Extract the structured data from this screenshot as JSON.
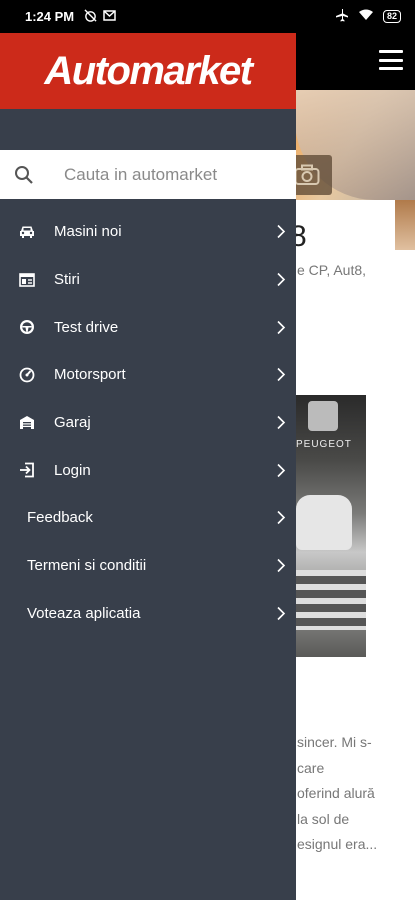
{
  "status_bar": {
    "time": "1:24 PM",
    "battery": "82"
  },
  "drawer": {
    "logo": "Automarket",
    "search": {
      "placeholder": "Cauta in automarket"
    },
    "items": [
      {
        "label": "Masini noi",
        "icon": "car-icon"
      },
      {
        "label": "Stiri",
        "icon": "news-icon"
      },
      {
        "label": "Test drive",
        "icon": "steering-wheel-icon"
      },
      {
        "label": "Motorsport",
        "icon": "speedometer-icon"
      },
      {
        "label": "Garaj",
        "icon": "garage-icon"
      },
      {
        "label": "Login",
        "icon": "login-icon"
      },
      {
        "label": "Feedback",
        "icon": ""
      },
      {
        "label": "Termeni si conditii",
        "icon": ""
      },
      {
        "label": "Voteaza aplicatia",
        "icon": ""
      }
    ]
  },
  "background": {
    "title": "8",
    "subtitle": "e CP, Aut8,",
    "image_brand": "PEUGEOT",
    "excerpt": [
      "sincer. Mi s-",
      "care",
      "oferind alură",
      "la sol de",
      "esignul era..."
    ]
  },
  "colors": {
    "drawer_bg": "#383f4b",
    "header_red": "#cc2a1a",
    "menu_text": "#ffffff"
  }
}
